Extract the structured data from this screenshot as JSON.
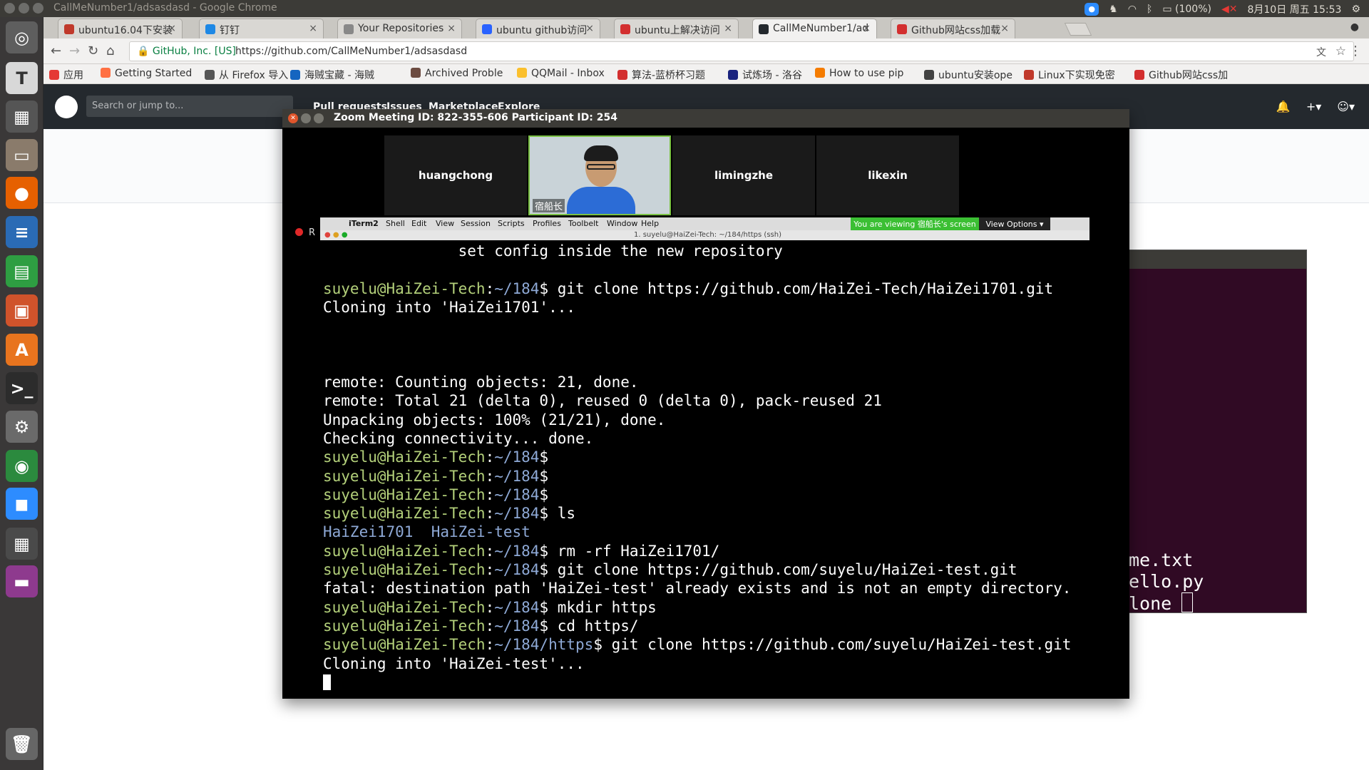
{
  "topbar": {
    "window_title": "CallMeNumber1/adsasdasd - Google Chrome",
    "battery": "(100%)",
    "datetime": "8月10日 周五 15:53"
  },
  "tabs": [
    {
      "label": "ubuntu16.04下安装",
      "favicon": "brand-b-icon",
      "color": "#c0392b"
    },
    {
      "label": "钉钉",
      "favicon": "dingtalk-icon",
      "color": "#1e88e5"
    },
    {
      "label": "Your Repositories",
      "favicon": "page-icon",
      "color": "#888888"
    },
    {
      "label": "ubuntu github访问",
      "favicon": "paw-icon",
      "color": "#2962ff"
    },
    {
      "label": "ubuntu上解决访问",
      "favicon": "csdn-icon",
      "color": "#d32f2f"
    },
    {
      "label": "CallMeNumber1/ad",
      "favicon": "github-icon",
      "color": "#24292e"
    },
    {
      "label": "Github网站css加载",
      "favicon": "csdn-icon",
      "color": "#d32f2f"
    }
  ],
  "omnibox": {
    "secure_label": "GitHub, Inc. [US]",
    "url": "https://github.com/CallMeNumber1/adsasdasd"
  },
  "bookmarks": [
    {
      "label": "应用",
      "color": "#e53935"
    },
    {
      "label": "Getting Started",
      "color": "#ff7043"
    },
    {
      "label": "从 Firefox 导入",
      "color": "#555555"
    },
    {
      "label": "海贼宝藏 - 海贼",
      "color": "#1565c0"
    },
    {
      "label": "Archived Proble",
      "color": "#6d4c41"
    },
    {
      "label": "QQMail - Inbox",
      "color": "#fbc02d"
    },
    {
      "label": "算法-蓝桥杯习题",
      "color": "#d32f2f"
    },
    {
      "label": "试炼场 - 洛谷",
      "color": "#1a237e"
    },
    {
      "label": "How to use pip",
      "color": "#f57c00"
    },
    {
      "label": "ubuntu安装ope",
      "color": "#424242"
    },
    {
      "label": "Linux下实现免密",
      "color": "#c0392b"
    },
    {
      "label": "Github网站css加",
      "color": "#d32f2f"
    }
  ],
  "github": {
    "search_placeholder": "Search or jump to...",
    "nav": [
      "Pull requests",
      "Issues",
      "Marketplace",
      "Explore"
    ]
  },
  "zoom": {
    "title": "Zoom Meeting ID: 822-355-606  Participant ID: 254",
    "participants": [
      "huangchong",
      "宿船长",
      "limingzhe",
      "likexin"
    ],
    "record_label": "R",
    "viewing_banner": "You are viewing 宿船长's screen",
    "view_options": "View Options"
  },
  "mac_menu": {
    "items": [
      "iTerm2",
      "Shell",
      "Edit",
      "View",
      "Session",
      "Scripts",
      "Profiles",
      "Toolbelt",
      "Window",
      "Help"
    ],
    "window_title": "1. suyelu@HaiZei-Tech: ~/184/https (ssh)"
  },
  "terminal": {
    "lines": [
      {
        "type": "out",
        "text": "               set config inside the new repository"
      },
      {
        "type": "blank"
      },
      {
        "type": "cmd",
        "user": "suyelu@HaiZei-Tech",
        "path": "~/184",
        "cmd": " git clone https://github.com/HaiZei-Tech/HaiZei1701.git"
      },
      {
        "type": "out",
        "text": "Cloning into 'HaiZei1701'..."
      },
      {
        "type": "blank"
      },
      {
        "type": "blank"
      },
      {
        "type": "blank"
      },
      {
        "type": "out",
        "text": "remote: Counting objects: 21, done."
      },
      {
        "type": "out",
        "text": "remote: Total 21 (delta 0), reused 0 (delta 0), pack-reused 21"
      },
      {
        "type": "out",
        "text": "Unpacking objects: 100% (21/21), done."
      },
      {
        "type": "out",
        "text": "Checking connectivity... done."
      },
      {
        "type": "cmd",
        "user": "suyelu@HaiZei-Tech",
        "path": "~/184",
        "cmd": ""
      },
      {
        "type": "cmd",
        "user": "suyelu@HaiZei-Tech",
        "path": "~/184",
        "cmd": ""
      },
      {
        "type": "cmd",
        "user": "suyelu@HaiZei-Tech",
        "path": "~/184",
        "cmd": ""
      },
      {
        "type": "cmd",
        "user": "suyelu@HaiZei-Tech",
        "path": "~/184",
        "cmd": " ls"
      },
      {
        "type": "ls",
        "text": "HaiZei1701  HaiZei-test"
      },
      {
        "type": "cmd",
        "user": "suyelu@HaiZei-Tech",
        "path": "~/184",
        "cmd": " rm -rf HaiZei1701/"
      },
      {
        "type": "cmd",
        "user": "suyelu@HaiZei-Tech",
        "path": "~/184",
        "cmd": " git clone https://github.com/suyelu/HaiZei-test.git"
      },
      {
        "type": "out",
        "text": "fatal: destination path 'HaiZei-test' already exists and is not an empty directory."
      },
      {
        "type": "cmd",
        "user": "suyelu@HaiZei-Tech",
        "path": "~/184",
        "cmd": " mkdir https"
      },
      {
        "type": "cmd",
        "user": "suyelu@HaiZei-Tech",
        "path": "~/184",
        "cmd": " cd https/"
      },
      {
        "type": "cmd",
        "user": "suyelu@HaiZei-Tech",
        "path": "~/184/https",
        "cmd": " git clone https://github.com/suyelu/HaiZei-test.git"
      },
      {
        "type": "out",
        "text": "Cloning into 'HaiZei-test'..."
      },
      {
        "type": "cursor"
      }
    ]
  },
  "background_terminal": {
    "lines": [
      "me.txt",
      "ello.py",
      "lone"
    ]
  },
  "launcher": [
    {
      "name": "dash-icon",
      "color": "#5e5e5e",
      "glyph": "◎"
    },
    {
      "name": "text-editor-icon",
      "color": "#d8d8d8",
      "glyph": "T"
    },
    {
      "name": "calculator-icon",
      "color": "#555555",
      "glyph": "▦"
    },
    {
      "name": "files-icon",
      "color": "#8a7b6b",
      "glyph": "▭"
    },
    {
      "name": "firefox-icon",
      "color": "#e66000",
      "glyph": "●"
    },
    {
      "name": "writer-icon",
      "color": "#2a6bb5",
      "glyph": "≡"
    },
    {
      "name": "calc-icon",
      "color": "#2e9e42",
      "glyph": "▤"
    },
    {
      "name": "impress-icon",
      "color": "#d0532b",
      "glyph": "▣"
    },
    {
      "name": "software-center-icon",
      "color": "#e8741e",
      "glyph": "A"
    },
    {
      "name": "terminal-icon",
      "color": "#2c2c2c",
      "glyph": ">_"
    },
    {
      "name": "settings-icon",
      "color": "#6a6a6a",
      "glyph": "⚙"
    },
    {
      "name": "chrome-icon",
      "color": "#2b8a3e",
      "glyph": "◉"
    },
    {
      "name": "zoom-icon",
      "color": "#2d8cff",
      "glyph": "◼"
    },
    {
      "name": "workspace-icon",
      "color": "#4a4a4a",
      "glyph": "▦"
    },
    {
      "name": "app-icon",
      "color": "#8e3a8e",
      "glyph": "▬"
    },
    {
      "name": "trash-icon",
      "color": "#666666",
      "glyph": "🗑"
    }
  ]
}
